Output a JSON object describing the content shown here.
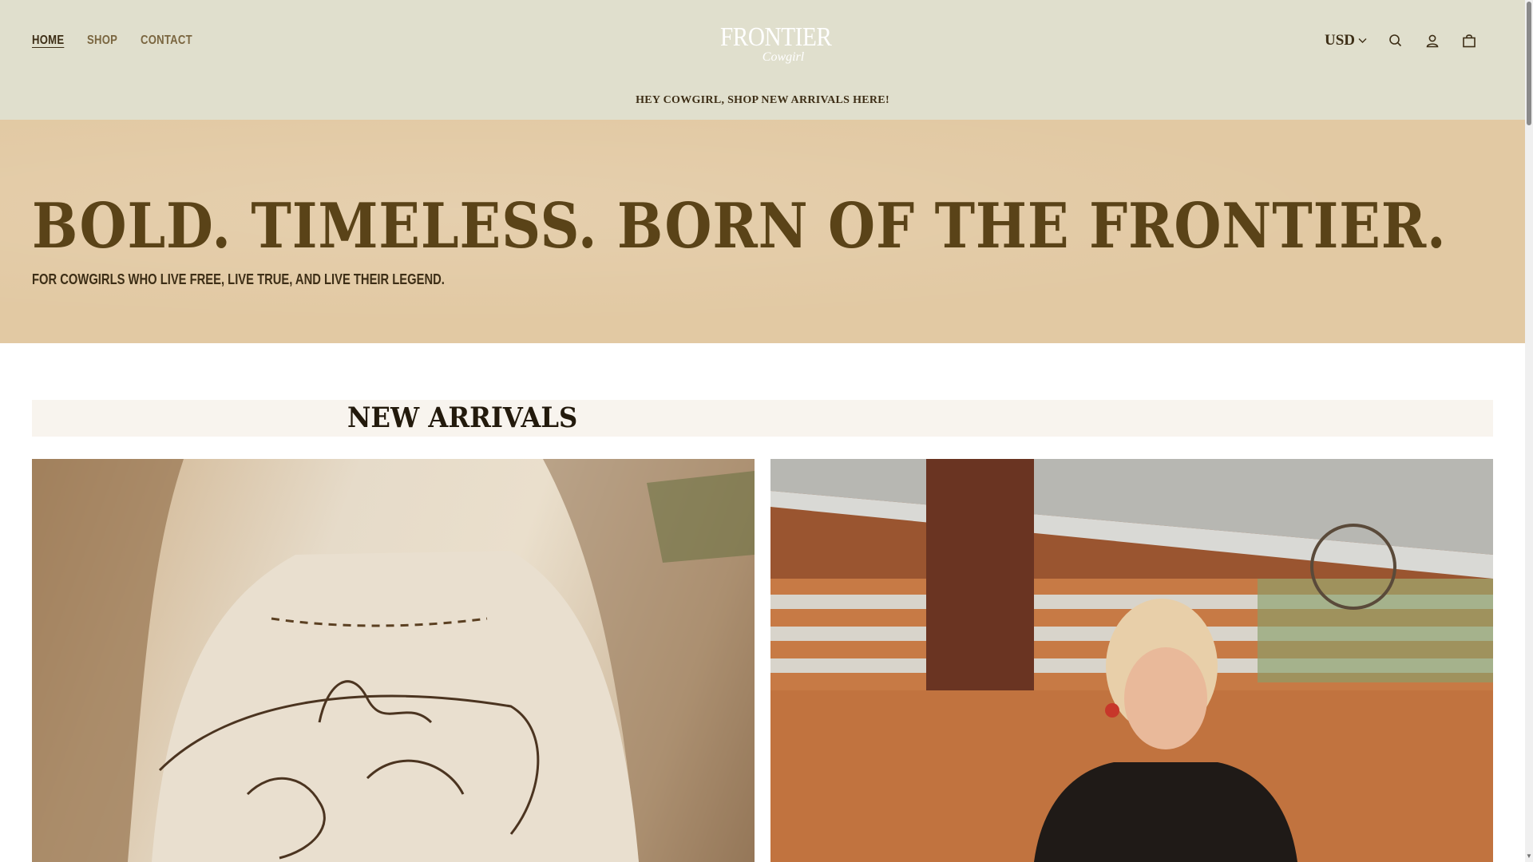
{
  "header": {
    "nav": [
      {
        "label": "HOME",
        "active": true
      },
      {
        "label": "SHOP",
        "active": false
      },
      {
        "label": "CONTACT",
        "active": false
      }
    ],
    "logo": {
      "main": "FRONTIER",
      "sub": "Cowgirl"
    },
    "currency": "USD",
    "icons": [
      "search-icon",
      "account-icon",
      "cart-icon",
      "chevron-down-icon"
    ]
  },
  "announcement": "HEY COWGIRL, SHOP NEW ARRIVALS HERE!",
  "hero": {
    "title": "BOLD. TIMELESS. BORN OF THE FRONTIER.",
    "subtitle": "FOR COWGIRLS WHO LIVE FREE, LIVE TRUE, AND LIVE THEIR LEGEND."
  },
  "section": {
    "title": "NEW ARRIVALS"
  },
  "colors": {
    "header_bg": "#e0dfcd",
    "hero_bg": "#e2c9a3",
    "hero_title": "#5a4318",
    "section_bar_bg": "#f8f4ee",
    "text_dark": "#3d2e16"
  }
}
